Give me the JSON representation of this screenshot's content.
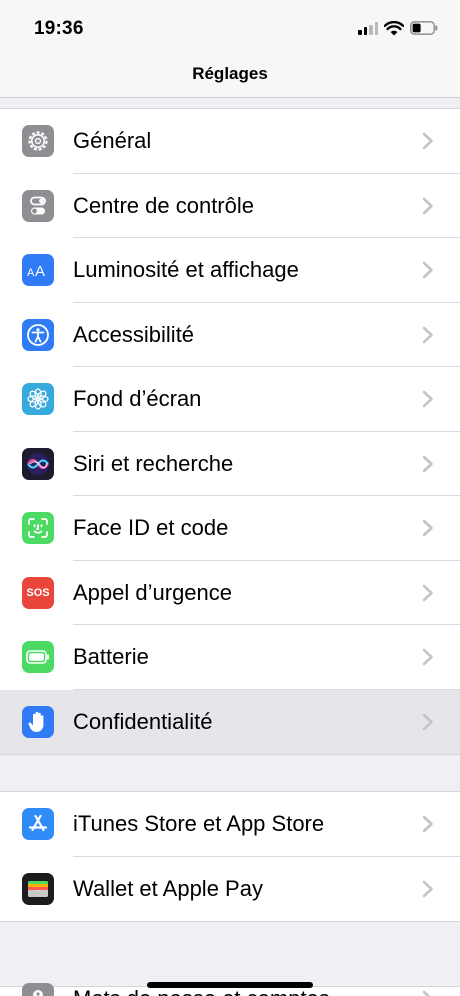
{
  "status_bar": {
    "time": "19:36"
  },
  "nav": {
    "title": "Réglages"
  },
  "groups": [
    {
      "items": [
        {
          "label": "Général",
          "icon": "gear-icon",
          "color": "#8e8e93"
        },
        {
          "label": "Centre de contrôle",
          "icon": "toggles-icon",
          "color": "#8e8e93"
        },
        {
          "label": "Luminosité et affichage",
          "icon": "text-size-icon",
          "color": "#2f7cf6"
        },
        {
          "label": "Accessibilité",
          "icon": "accessibility-icon",
          "color": "#2f7cf6"
        },
        {
          "label": "Fond d’écran",
          "icon": "flower-icon",
          "color": "#36aadc"
        },
        {
          "label": "Siri et recherche",
          "icon": "siri-icon",
          "color": "#1c1c2e"
        },
        {
          "label": "Face ID et code",
          "icon": "face-id-icon",
          "color": "#4cd964"
        },
        {
          "label": "Appel d’urgence",
          "icon": "sos-icon",
          "color": "#e9453b",
          "icon_text": "SOS"
        },
        {
          "label": "Batterie",
          "icon": "battery-icon",
          "color": "#4cd964"
        },
        {
          "label": "Confidentialité",
          "icon": "hand-icon",
          "color": "#2f7cf6",
          "highlighted": true
        }
      ]
    },
    {
      "items": [
        {
          "label": "iTunes Store et App Store",
          "icon": "app-store-icon",
          "color": "#2f8cf6"
        },
        {
          "label": "Wallet et Apple Pay",
          "icon": "wallet-icon",
          "color": "#1c1c1e"
        }
      ]
    },
    {
      "items": [
        {
          "label": "Mots de passe et comptes",
          "icon": "key-icon",
          "color": "#8e8e93"
        }
      ]
    }
  ]
}
